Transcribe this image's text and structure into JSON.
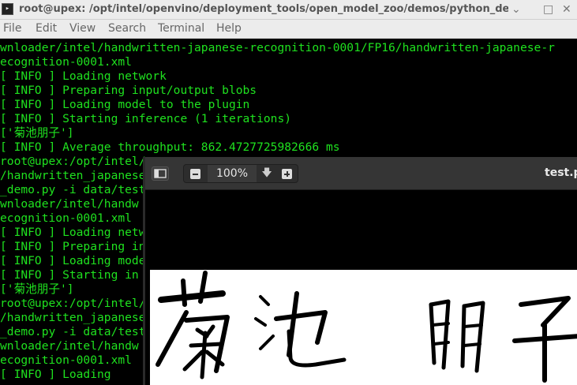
{
  "window": {
    "title": "root@upex: /opt/intel/openvino/deployment_tools/open_model_zoo/demos/python_demos/h",
    "terminal_icon": "terminal-icon",
    "minimize_glyph": "⌄",
    "maximize_glyph": "□",
    "close_glyph": "✕"
  },
  "menu": {
    "items": [
      "File",
      "Edit",
      "View",
      "Search",
      "Terminal",
      "Help"
    ]
  },
  "terminal": {
    "lines": [
      "wnloader/intel/handwritten-japanese-recognition-0001/FP16/handwritten-japanese-r",
      "ecognition-0001.xml",
      "[ INFO ] Loading network",
      "[ INFO ] Preparing input/output blobs",
      "[ INFO ] Loading model to the plugin",
      "[ INFO ] Starting inference (1 iterations)",
      "['菊池朋子']",
      "[ INFO ] Average throughput: 862.4727725982666 ms",
      "root@upex:/opt/intel/",
      "/handwritten_japanese",
      "_demo.py -i data/test",
      "wnloader/intel/handw",
      "ecognition-0001.xml",
      "[ INFO ] Loading netw",
      "[ INFO ] Preparing in",
      "[ INFO ] Loading mode",
      "[ INFO ] Starting in",
      "['菊池朋子']",
      "root@upex:/opt/intel/",
      "/handwritten_japanese",
      "_demo.py -i data/test",
      "wnloader/intel/handw",
      "ecognition-0001.xml",
      "[ INFO ] Loading"
    ]
  },
  "viewer": {
    "zoom_level": "100%",
    "zoom_menu_glyph": "🡇",
    "document_title": "test.p",
    "page_text": "菊池朋子",
    "icons": {
      "sidebar": "sidebar-toggle-icon",
      "zoom_out": "minus-icon",
      "zoom_in": "plus-icon",
      "dropdown": "arrow-down-icon"
    }
  }
}
